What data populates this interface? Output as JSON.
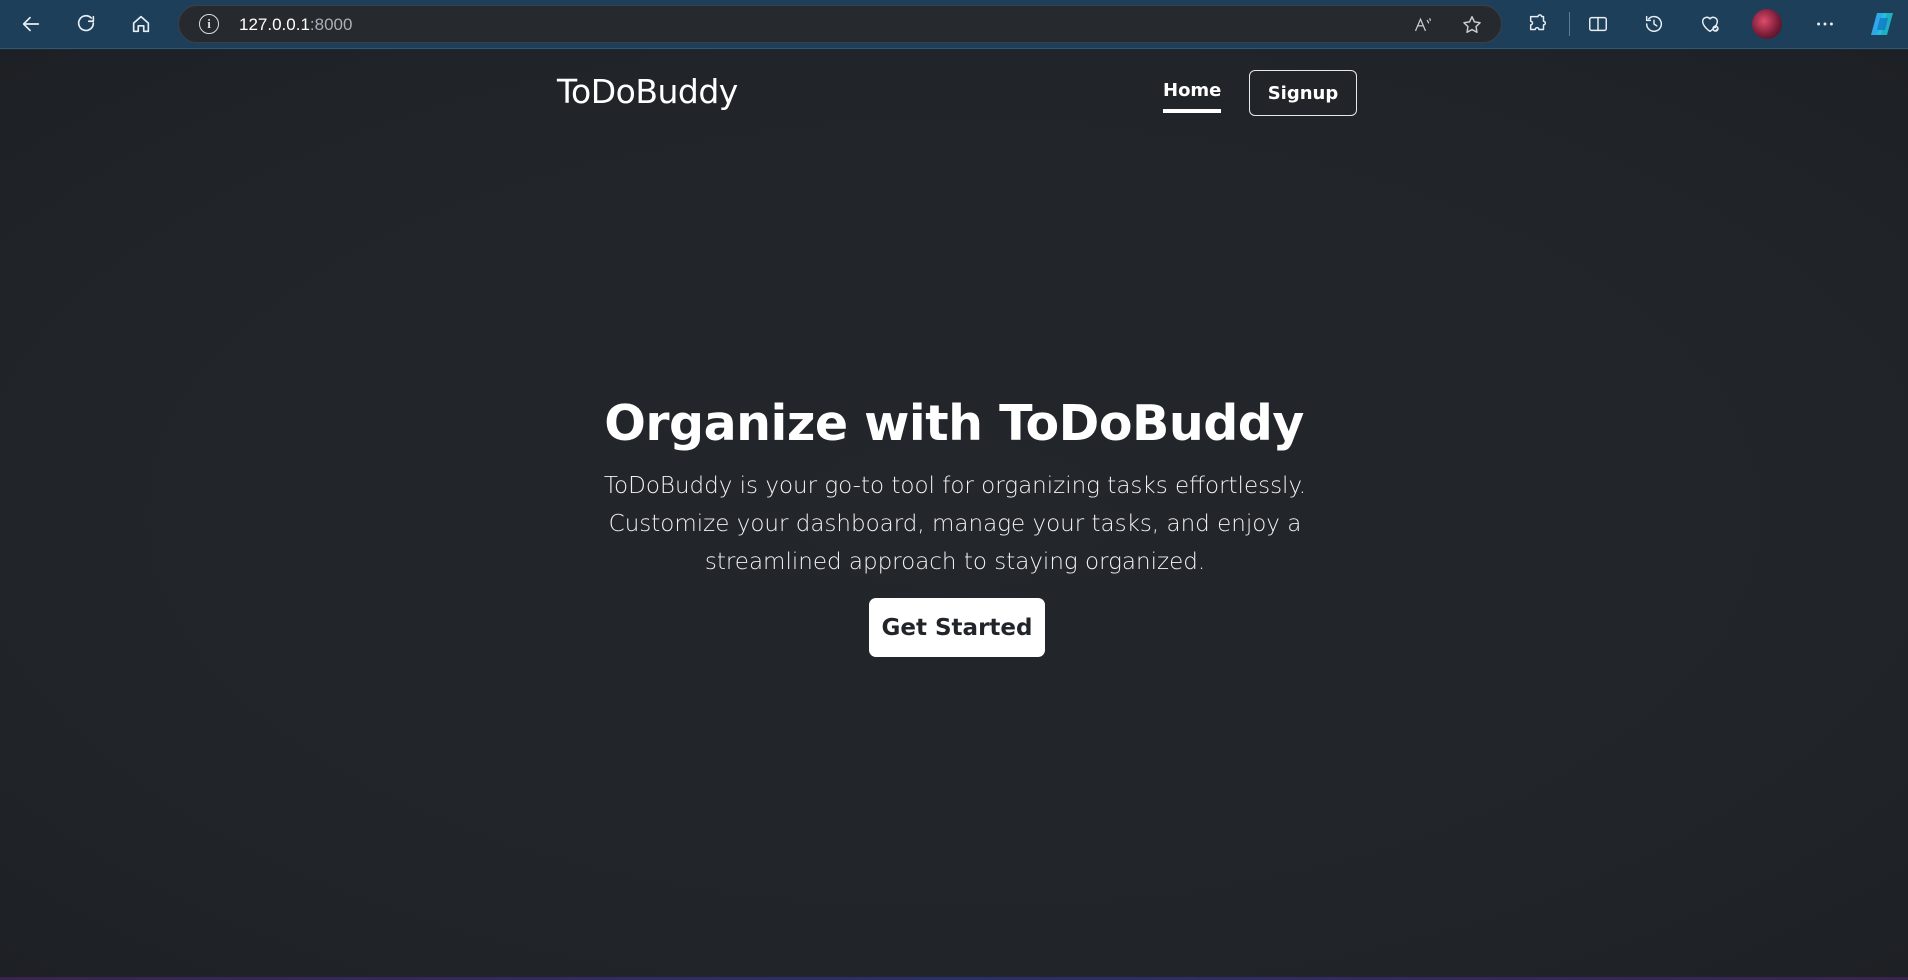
{
  "browser": {
    "url_host": "127.0.0.1",
    "url_port": ":8000",
    "icons": {
      "back": "back-arrow-icon",
      "refresh": "refresh-icon",
      "home": "home-icon",
      "info": "site-info-icon",
      "read_aloud": "read-aloud-icon",
      "favorite": "favorite-star-icon",
      "extensions": "extensions-icon",
      "split": "split-screen-icon",
      "history": "history-icon",
      "health": "browser-essentials-icon",
      "profile": "profile-avatar",
      "more": "more-options-icon",
      "copilot": "copilot-icon"
    },
    "info_glyph": "i"
  },
  "navbar": {
    "brand": "ToDoBuddy",
    "links": [
      {
        "label": "Home",
        "active": true
      },
      {
        "label": "Signup",
        "active": false
      }
    ]
  },
  "hero": {
    "title": "Organize with ToDoBuddy",
    "description": "ToDoBuddy is your go-to tool for organizing tasks effortlessly. Customize your dashboard, manage your tasks, and enjoy a streamlined approach to staying organized.",
    "cta_label": "Get Started"
  },
  "colors": {
    "page_background": "#212529",
    "chrome_background": "#1d3f5a",
    "text": "#ffffff",
    "button_background": "#ffffff",
    "button_text": "#212529"
  }
}
